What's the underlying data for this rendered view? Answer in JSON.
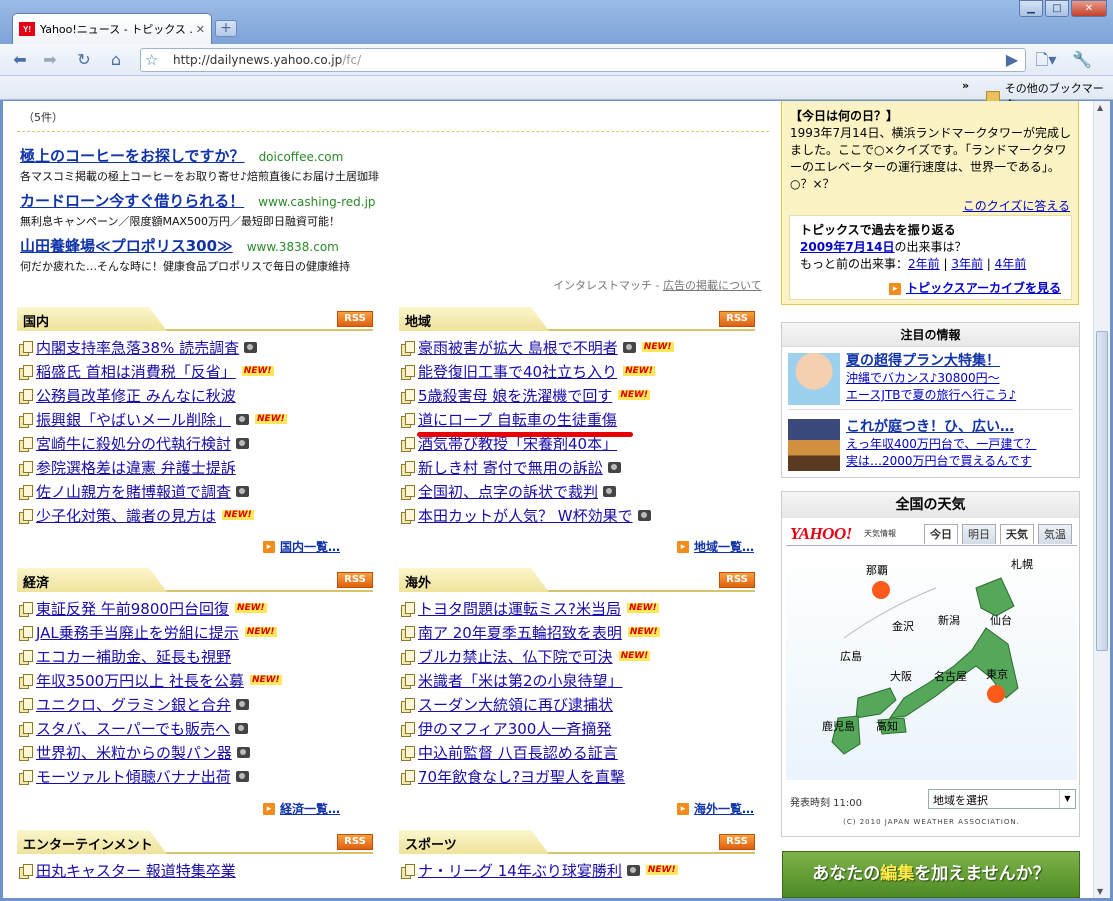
{
  "browser": {
    "tab_title": "Yahoo!ニュース - トピックス ...",
    "tab_favicon": "Y!",
    "url_host": "http://dailynews.yahoo.co.jp",
    "url_path": "/fc/",
    "bookmarks_other": "その他のブックマーク",
    "bookmarks_chevron": "»"
  },
  "ads": {
    "count": "（5件）",
    "items": [
      {
        "title": "極上のコーヒーをお探しですか？",
        "domain": "doicoffee.com",
        "desc": "各マスコミ掲載の極上コーヒーをお取り寄せ♪焙煎直後にお届け土居珈琲"
      },
      {
        "title": "カードローン今すぐ借りられる！",
        "domain": "www.cashing-red.jp",
        "desc": "無利息キャンペーン／限度額MAX500万円／最短即日融資可能！"
      },
      {
        "title": "山田養蜂場≪プロポリス300≫",
        "domain": "www.3838.com",
        "desc": "何だか疲れた…そんな時に！健康食品プロポリスで毎日の健康維持"
      }
    ],
    "footer_a": "インタレストマッチ - ",
    "footer_b": "広告の掲載について"
  },
  "sections": {
    "domestic": {
      "title": "国内",
      "rss": "RSS",
      "more": "国内一覧…",
      "items": [
        {
          "t": "内閣支持率急落38% 読売調査",
          "badge": "cam"
        },
        {
          "t": "稲盛氏 首相は消費税「反省」",
          "badge": "new"
        },
        {
          "t": "公務員改革修正 みんなに秋波",
          "badge": ""
        },
        {
          "t": "振興銀「やばいメール削除」",
          "badge": "cam-new"
        },
        {
          "t": "宮崎牛に殺処分の代執行検討",
          "badge": "cam"
        },
        {
          "t": "参院選格差は違憲 弁護士提訴",
          "badge": ""
        },
        {
          "t": "佐ノ山親方を賭博報道で調査",
          "badge": "cam"
        },
        {
          "t": "少子化対策、識者の見方は",
          "badge": "new"
        }
      ]
    },
    "region": {
      "title": "地域",
      "rss": "RSS",
      "more": "地域一覧…",
      "items": [
        {
          "t": "豪雨被害が拡大 島根で不明者",
          "badge": "cam-new"
        },
        {
          "t": "能登復旧工事で40社立ち入り",
          "badge": "new"
        },
        {
          "t": "5歳殺害母 娘を洗濯機で回す",
          "badge": "new"
        },
        {
          "t": "道にロープ 自転車の生徒重傷",
          "badge": ""
        },
        {
          "t": "酒気帯び教授「宋養剤40本」",
          "badge": ""
        },
        {
          "t": "新しき村 寄付で無用の訴訟",
          "badge": "cam"
        },
        {
          "t": "全国初、点字の訴状で裁判",
          "badge": "cam"
        },
        {
          "t": "本田カットが人気？ W杯効果で",
          "badge": "cam"
        }
      ]
    },
    "economy": {
      "title": "経済",
      "rss": "RSS",
      "more": "経済一覧…",
      "items": [
        {
          "t": "東証反発 午前9800円台回復",
          "badge": "new"
        },
        {
          "t": "JAL乗務手当廃止を労組に提示",
          "badge": "new"
        },
        {
          "t": "エコカー補助金、延長も視野",
          "badge": ""
        },
        {
          "t": "年収3500万円以上 社長を公募",
          "badge": "new"
        },
        {
          "t": "ユニクロ、グラミン銀と合弁",
          "badge": "cam"
        },
        {
          "t": "スタバ、スーパーでも販売へ",
          "badge": "cam"
        },
        {
          "t": "世界初、米粒からの製パン器",
          "badge": "cam"
        },
        {
          "t": "モーツァルト傾聴バナナ出荷",
          "badge": "cam"
        }
      ]
    },
    "world": {
      "title": "海外",
      "rss": "RSS",
      "more": "海外一覧…",
      "items": [
        {
          "t": "トヨタ問題は運転ミス?米当局",
          "badge": "new"
        },
        {
          "t": "南ア 20年夏季五輪招致を表明",
          "badge": "new"
        },
        {
          "t": "ブルカ禁止法、仏下院で可決",
          "badge": "new"
        },
        {
          "t": "米識者「米は第2の小泉待望」",
          "badge": ""
        },
        {
          "t": "スーダン大統領に再び逮捕状",
          "badge": ""
        },
        {
          "t": "伊のマフィア300人一斉摘発",
          "badge": ""
        },
        {
          "t": "中込前監督 八百長認める証言",
          "badge": ""
        },
        {
          "t": "70年飲食なし?ヨガ聖人を直撃",
          "badge": ""
        }
      ]
    },
    "entertainment": {
      "title": "エンターテインメント",
      "rss": "RSS",
      "items": [
        {
          "t": "田丸キャスター 報道特集卒業",
          "badge": ""
        }
      ]
    },
    "sports": {
      "title": "スポーツ",
      "rss": "RSS",
      "items": [
        {
          "t": "ナ・リーグ 14年ぶり球宴勝利",
          "badge": "cam-new"
        }
      ]
    }
  },
  "badges": {
    "new": "NEW!"
  },
  "quiz": {
    "head": "【今日は何の日？】",
    "body": "1993年7月14日、横浜ランドマークタワーが完成しました。ここで○×クイズです。「ランドマークタワーのエレベーターの運行速度は、世界一である」。○？×？",
    "answer": "このクイズに答える",
    "past_title": "トピックスで過去を振り返る",
    "past_date": "2009年7月14日",
    "past_suffix": "の出来事は？",
    "past_more": "もっと前の出来事：",
    "y2": "2年前",
    "y3": "3年前",
    "y4": "4年前",
    "archive": "トピックスアーカイブを見る"
  },
  "featured": {
    "title": "注目の情報",
    "items": [
      {
        "big": "夏の超得プラン大特集！",
        "l1": "沖縄でバカンス♪30800円～",
        "l2": "エースJTBで夏の旅行へ行こう♪"
      },
      {
        "big": "これが庭つき！ひ、広い…",
        "l1": "えっ年収400万円台で、一戸建て？",
        "l2": "実は…2000万円台で買えるんです"
      }
    ]
  },
  "weather": {
    "title": "全国の天気",
    "logo": "YAHOO!",
    "logo_sub": "天気情報",
    "tabs": [
      "今日",
      "明日",
      "天気",
      "気温"
    ],
    "cities": [
      "札幌",
      "那覇",
      "金沢",
      "新潟",
      "仙台",
      "広島",
      "大阪",
      "名古屋",
      "東京",
      "鹿児島",
      "高知"
    ],
    "issued": "発表時刻 11:00",
    "select": "地域を選択",
    "copyright": "(C) 2010 JAPAN WEATHER ASSOCIATION."
  },
  "banner": {
    "a": "あなたの",
    "b": "編集",
    "c": "を加えませんか？"
  }
}
